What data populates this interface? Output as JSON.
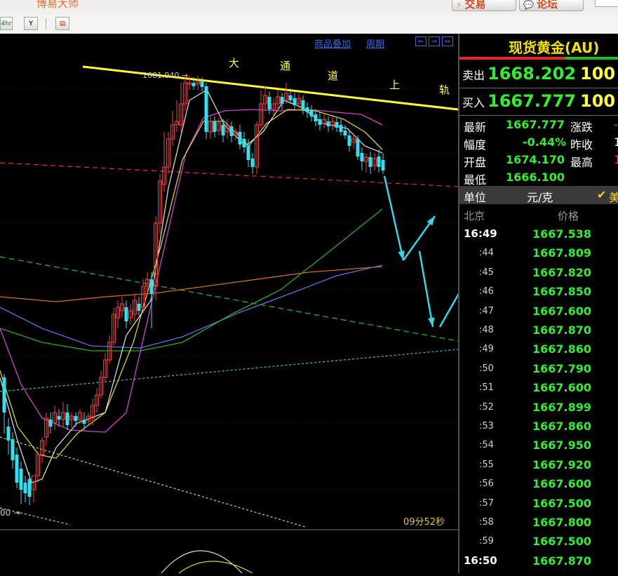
{
  "app": {
    "title": "博易大师",
    "trade_label": "交易",
    "forum_label": "论坛"
  },
  "toolbar": {
    "buttons": [
      {
        "label": "4hr",
        "icon": "hourly-icon"
      },
      {
        "label": "Y",
        "icon": "filter-icon"
      },
      {
        "label": "▤",
        "icon": "grid-icon"
      }
    ]
  },
  "chart": {
    "menu": [
      "商品叠加",
      "周期"
    ],
    "nav_arrows": [
      "⇐",
      "⇒",
      "⇔"
    ],
    "high_label": "1681.940 →",
    "low_label": "00 →",
    "annotation_chars": [
      "大",
      "通",
      "道",
      "上",
      "轨"
    ],
    "countdown": "09分52秒",
    "colors": {
      "up": "#ff3a3a",
      "down": "#33e0f0",
      "ma_white": "#d8d8d8",
      "ma_yellow": "#d8d820",
      "ma_magenta": "#d040d0",
      "ma_green": "#20b020",
      "ma_blue": "#6a6ad8",
      "ma_orange": "#d07020",
      "trend_yellow": "#ffff30"
    }
  },
  "quote": {
    "title": "现货黄金(AU)",
    "sell_label": "卖出",
    "sell_price": "1668.202",
    "sell_vol": "100",
    "buy_label": "买入",
    "buy_price": "1667.777",
    "buy_vol": "100",
    "latest_label": "最新",
    "latest": "1667.777",
    "change_label": "涨跌",
    "change_partial": "-",
    "amp_label": "幅度",
    "amp": "-0.44%",
    "prev_close_label": "昨收",
    "prev_close_partial": "1",
    "open_label": "开盘",
    "open": "1674.170",
    "high_label": "最高",
    "high_partial": "1",
    "low_label": "最低",
    "low": "1666.100",
    "unit_label": "单位",
    "unit": "元/克",
    "currency_check": "✔",
    "currency_partial": "美",
    "ticks_header_time": "北京",
    "ticks_header_price": "价格"
  },
  "ticks": [
    {
      "time": "16:49",
      "price": "1667.538"
    },
    {
      "time": ":44",
      "price": "1667.809"
    },
    {
      "time": ":45",
      "price": "1667.820"
    },
    {
      "time": ":46",
      "price": "1667.850"
    },
    {
      "time": ":47",
      "price": "1667.600"
    },
    {
      "time": ":48",
      "price": "1667.870"
    },
    {
      "time": ":49",
      "price": "1667.860"
    },
    {
      "time": ":50",
      "price": "1667.790"
    },
    {
      "time": ":51",
      "price": "1667.600"
    },
    {
      "time": ":52",
      "price": "1667.899"
    },
    {
      "time": ":53",
      "price": "1667.860"
    },
    {
      "time": ":54",
      "price": "1667.950"
    },
    {
      "time": ":55",
      "price": "1667.920"
    },
    {
      "time": ":56",
      "price": "1667.600"
    },
    {
      "time": ":57",
      "price": "1667.500"
    },
    {
      "time": ":58",
      "price": "1667.800"
    },
    {
      "time": ":59",
      "price": "1667.500"
    },
    {
      "time": "16:50",
      "price": "1667.870"
    }
  ]
}
